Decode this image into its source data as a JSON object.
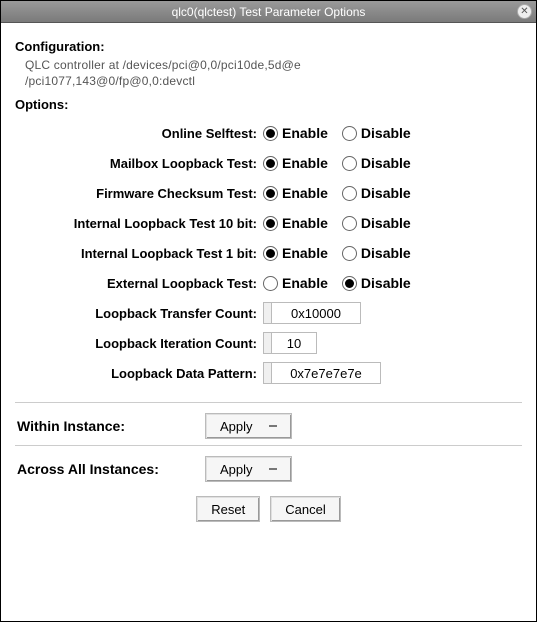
{
  "window": {
    "title": "qlc0(qlctest) Test Parameter Options"
  },
  "configuration": {
    "heading": "Configuration:",
    "line1": "QLC controller at /devices/pci@0,0/pci10de,5d@e",
    "line2": "/pci1077,143@0/fp@0,0:devctl"
  },
  "options_heading": "Options:",
  "labels": {
    "enable": "Enable",
    "disable": "Disable"
  },
  "tests": [
    {
      "id": "online-selftest",
      "label": "Online Selftest:",
      "value": "enable"
    },
    {
      "id": "mailbox-loopback",
      "label": "Mailbox Loopback Test:",
      "value": "enable"
    },
    {
      "id": "firmware-checksum",
      "label": "Firmware Checksum Test:",
      "value": "enable"
    },
    {
      "id": "internal-loop-10",
      "label": "Internal Loopback Test 10 bit:",
      "value": "enable"
    },
    {
      "id": "internal-loop-1",
      "label": "Internal Loopback Test  1 bit:",
      "value": "enable"
    },
    {
      "id": "external-loopback",
      "label": "External Loopback Test:",
      "value": "disable"
    }
  ],
  "fields": [
    {
      "id": "transfer-count",
      "label": "Loopback Transfer Count:",
      "value": "0x10000",
      "size": "w1"
    },
    {
      "id": "iteration-count",
      "label": "Loopback Iteration Count:",
      "value": "10",
      "size": "w2"
    },
    {
      "id": "data-pattern",
      "label": "Loopback Data Pattern:",
      "value": "0x7e7e7e7e",
      "size": "w3"
    }
  ],
  "apply": {
    "within_label": "Within Instance:",
    "across_label": "Across All Instances:",
    "button": "Apply"
  },
  "buttons": {
    "reset": "Reset",
    "cancel": "Cancel"
  }
}
